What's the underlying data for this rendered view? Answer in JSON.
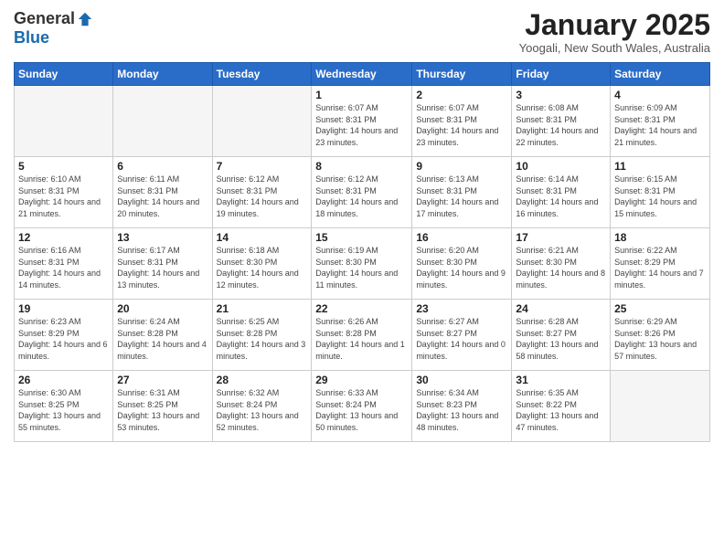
{
  "header": {
    "logo_general": "General",
    "logo_blue": "Blue",
    "month_title": "January 2025",
    "location": "Yoogali, New South Wales, Australia"
  },
  "days_of_week": [
    "Sunday",
    "Monday",
    "Tuesday",
    "Wednesday",
    "Thursday",
    "Friday",
    "Saturday"
  ],
  "weeks": [
    [
      {
        "day": "",
        "sunrise": "",
        "sunset": "",
        "daylight": "",
        "empty": true
      },
      {
        "day": "",
        "sunrise": "",
        "sunset": "",
        "daylight": "",
        "empty": true
      },
      {
        "day": "",
        "sunrise": "",
        "sunset": "",
        "daylight": "",
        "empty": true
      },
      {
        "day": "1",
        "sunrise": "Sunrise: 6:07 AM",
        "sunset": "Sunset: 8:31 PM",
        "daylight": "Daylight: 14 hours and 23 minutes."
      },
      {
        "day": "2",
        "sunrise": "Sunrise: 6:07 AM",
        "sunset": "Sunset: 8:31 PM",
        "daylight": "Daylight: 14 hours and 23 minutes."
      },
      {
        "day": "3",
        "sunrise": "Sunrise: 6:08 AM",
        "sunset": "Sunset: 8:31 PM",
        "daylight": "Daylight: 14 hours and 22 minutes."
      },
      {
        "day": "4",
        "sunrise": "Sunrise: 6:09 AM",
        "sunset": "Sunset: 8:31 PM",
        "daylight": "Daylight: 14 hours and 21 minutes."
      }
    ],
    [
      {
        "day": "5",
        "sunrise": "Sunrise: 6:10 AM",
        "sunset": "Sunset: 8:31 PM",
        "daylight": "Daylight: 14 hours and 21 minutes."
      },
      {
        "day": "6",
        "sunrise": "Sunrise: 6:11 AM",
        "sunset": "Sunset: 8:31 PM",
        "daylight": "Daylight: 14 hours and 20 minutes."
      },
      {
        "day": "7",
        "sunrise": "Sunrise: 6:12 AM",
        "sunset": "Sunset: 8:31 PM",
        "daylight": "Daylight: 14 hours and 19 minutes."
      },
      {
        "day": "8",
        "sunrise": "Sunrise: 6:12 AM",
        "sunset": "Sunset: 8:31 PM",
        "daylight": "Daylight: 14 hours and 18 minutes."
      },
      {
        "day": "9",
        "sunrise": "Sunrise: 6:13 AM",
        "sunset": "Sunset: 8:31 PM",
        "daylight": "Daylight: 14 hours and 17 minutes."
      },
      {
        "day": "10",
        "sunrise": "Sunrise: 6:14 AM",
        "sunset": "Sunset: 8:31 PM",
        "daylight": "Daylight: 14 hours and 16 minutes."
      },
      {
        "day": "11",
        "sunrise": "Sunrise: 6:15 AM",
        "sunset": "Sunset: 8:31 PM",
        "daylight": "Daylight: 14 hours and 15 minutes."
      }
    ],
    [
      {
        "day": "12",
        "sunrise": "Sunrise: 6:16 AM",
        "sunset": "Sunset: 8:31 PM",
        "daylight": "Daylight: 14 hours and 14 minutes."
      },
      {
        "day": "13",
        "sunrise": "Sunrise: 6:17 AM",
        "sunset": "Sunset: 8:31 PM",
        "daylight": "Daylight: 14 hours and 13 minutes."
      },
      {
        "day": "14",
        "sunrise": "Sunrise: 6:18 AM",
        "sunset": "Sunset: 8:30 PM",
        "daylight": "Daylight: 14 hours and 12 minutes."
      },
      {
        "day": "15",
        "sunrise": "Sunrise: 6:19 AM",
        "sunset": "Sunset: 8:30 PM",
        "daylight": "Daylight: 14 hours and 11 minutes."
      },
      {
        "day": "16",
        "sunrise": "Sunrise: 6:20 AM",
        "sunset": "Sunset: 8:30 PM",
        "daylight": "Daylight: 14 hours and 9 minutes."
      },
      {
        "day": "17",
        "sunrise": "Sunrise: 6:21 AM",
        "sunset": "Sunset: 8:30 PM",
        "daylight": "Daylight: 14 hours and 8 minutes."
      },
      {
        "day": "18",
        "sunrise": "Sunrise: 6:22 AM",
        "sunset": "Sunset: 8:29 PM",
        "daylight": "Daylight: 14 hours and 7 minutes."
      }
    ],
    [
      {
        "day": "19",
        "sunrise": "Sunrise: 6:23 AM",
        "sunset": "Sunset: 8:29 PM",
        "daylight": "Daylight: 14 hours and 6 minutes."
      },
      {
        "day": "20",
        "sunrise": "Sunrise: 6:24 AM",
        "sunset": "Sunset: 8:28 PM",
        "daylight": "Daylight: 14 hours and 4 minutes."
      },
      {
        "day": "21",
        "sunrise": "Sunrise: 6:25 AM",
        "sunset": "Sunset: 8:28 PM",
        "daylight": "Daylight: 14 hours and 3 minutes."
      },
      {
        "day": "22",
        "sunrise": "Sunrise: 6:26 AM",
        "sunset": "Sunset: 8:28 PM",
        "daylight": "Daylight: 14 hours and 1 minute."
      },
      {
        "day": "23",
        "sunrise": "Sunrise: 6:27 AM",
        "sunset": "Sunset: 8:27 PM",
        "daylight": "Daylight: 14 hours and 0 minutes."
      },
      {
        "day": "24",
        "sunrise": "Sunrise: 6:28 AM",
        "sunset": "Sunset: 8:27 PM",
        "daylight": "Daylight: 13 hours and 58 minutes."
      },
      {
        "day": "25",
        "sunrise": "Sunrise: 6:29 AM",
        "sunset": "Sunset: 8:26 PM",
        "daylight": "Daylight: 13 hours and 57 minutes."
      }
    ],
    [
      {
        "day": "26",
        "sunrise": "Sunrise: 6:30 AM",
        "sunset": "Sunset: 8:25 PM",
        "daylight": "Daylight: 13 hours and 55 minutes."
      },
      {
        "day": "27",
        "sunrise": "Sunrise: 6:31 AM",
        "sunset": "Sunset: 8:25 PM",
        "daylight": "Daylight: 13 hours and 53 minutes."
      },
      {
        "day": "28",
        "sunrise": "Sunrise: 6:32 AM",
        "sunset": "Sunset: 8:24 PM",
        "daylight": "Daylight: 13 hours and 52 minutes."
      },
      {
        "day": "29",
        "sunrise": "Sunrise: 6:33 AM",
        "sunset": "Sunset: 8:24 PM",
        "daylight": "Daylight: 13 hours and 50 minutes."
      },
      {
        "day": "30",
        "sunrise": "Sunrise: 6:34 AM",
        "sunset": "Sunset: 8:23 PM",
        "daylight": "Daylight: 13 hours and 48 minutes."
      },
      {
        "day": "31",
        "sunrise": "Sunrise: 6:35 AM",
        "sunset": "Sunset: 8:22 PM",
        "daylight": "Daylight: 13 hours and 47 minutes."
      },
      {
        "day": "",
        "sunrise": "",
        "sunset": "",
        "daylight": "",
        "empty": true
      }
    ]
  ]
}
